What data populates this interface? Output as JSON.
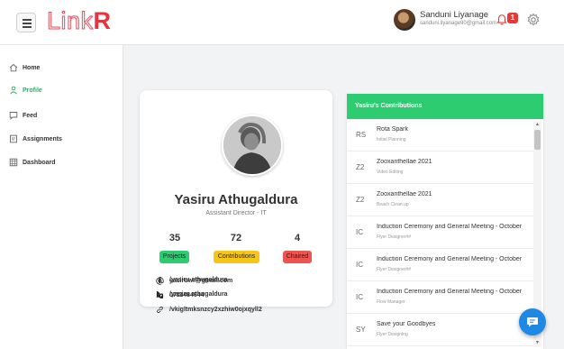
{
  "app": {
    "logo_part1": "Link",
    "logo_part2": "R"
  },
  "header": {
    "user_name": "Sanduni Liyanage",
    "user_email": "sanduni.liyanage90@gmail.com",
    "notification_count": "1",
    "icons": [
      "menu-icon",
      "bell-icon",
      "gear-icon"
    ]
  },
  "sidebar": {
    "items": [
      {
        "label": "Home",
        "icon": "home-icon",
        "active": false
      },
      {
        "label": "Profile",
        "icon": "person-icon",
        "active": true
      },
      {
        "label": "Feed",
        "icon": "feed-icon",
        "active": false
      },
      {
        "label": "Assignments",
        "icon": "assignments-icon",
        "active": false
      },
      {
        "label": "Dashboard",
        "icon": "dashboard-icon",
        "active": false
      }
    ]
  },
  "profile": {
    "name": "Yasiru Athugaldura",
    "role": "Assistant Director - IT",
    "stats": [
      {
        "value": "35",
        "label": "Projects",
        "color": "#2ecc71"
      },
      {
        "value": "72",
        "label": "Contributions",
        "color": "#f5c518"
      },
      {
        "value": "4",
        "label": "Chaired",
        "color": "#ef5350"
      }
    ],
    "contact": [
      {
        "icon": "at-icon",
        "text": "yasiruwr@gmail.com"
      },
      {
        "icon": "phone-icon",
        "text": "0711484644"
      },
      {
        "icon": "link-icon",
        "text": "/vkigltmksnzcy2xzhiw0ojxqyll2"
      },
      {
        "icon": "facebook-icon",
        "text": "/yasiru athugaldura"
      },
      {
        "icon": "linkedin-icon",
        "text": "/yasiru athugaldura"
      }
    ]
  },
  "contributions": {
    "header": "Yasiru's Contributions",
    "items": [
      {
        "abbr": "RS",
        "title": "Rota Spark",
        "sub": "Initial Planning"
      },
      {
        "abbr": "Z2",
        "title": "Zooxanthellae 2021",
        "sub": "Video Editing"
      },
      {
        "abbr": "Z2",
        "title": "Zooxanthellae 2021",
        "sub": "Beach Clean up"
      },
      {
        "abbr": "IC",
        "title": "Induction Ceremony and General Meeting - October",
        "sub": "Flyer Designer##"
      },
      {
        "abbr": "IC",
        "title": "Induction Ceremony and General Meeting - October",
        "sub": "Flyer Designer##"
      },
      {
        "abbr": "IC",
        "title": "Induction Ceremony and General Meeting - October",
        "sub": "Flow Manager"
      },
      {
        "abbr": "SY",
        "title": "Save your Goodbyes",
        "sub": "Flyer Designing"
      }
    ]
  },
  "colors": {
    "accent": "#2ecc71",
    "brand": "#e8333f",
    "chat": "#1e88e5",
    "badge": "#e53935"
  }
}
